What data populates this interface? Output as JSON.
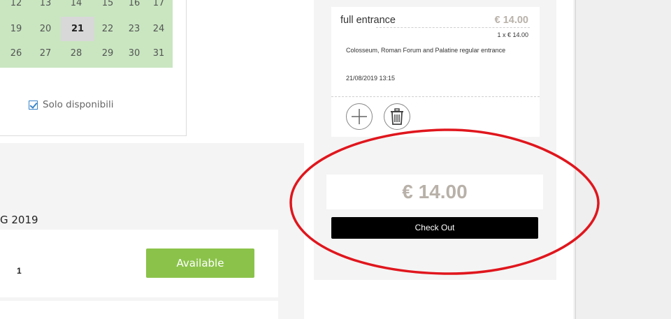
{
  "calendar": {
    "rows": [
      [
        "12",
        "13",
        "14",
        "15",
        "16",
        "17"
      ],
      [
        "19",
        "20",
        "21",
        "22",
        "23",
        "24"
      ],
      [
        "26",
        "27",
        "28",
        "29",
        "30",
        "31"
      ]
    ],
    "selected_day": "21",
    "filter_label": "Solo disponibili",
    "colors": {
      "available_bg": "#c9e6c0",
      "selected_bg": "#d8d8d8",
      "checkbox": "#3a86c8"
    }
  },
  "slots": {
    "date_title": "G 2019",
    "items": [
      {
        "number": "1",
        "button_label": "Available"
      }
    ],
    "colors": {
      "available_button": "#8bc34a"
    }
  },
  "cart": {
    "item": {
      "name": "full entrance",
      "price": "€ 14.00",
      "quantity_line": "1 x € 14.00",
      "description": "Colosseum, Roman Forum and Palatine regular entrance",
      "datetime": "21/08/2019 13:15"
    },
    "icons": {
      "add": "plus-icon",
      "remove": "trash-icon"
    },
    "total": "€ 14.00",
    "checkout_label": "Check Out",
    "colors": {
      "price": "#b8b1a9",
      "checkout_bg": "#000000",
      "annotation": "#e0161d"
    }
  }
}
